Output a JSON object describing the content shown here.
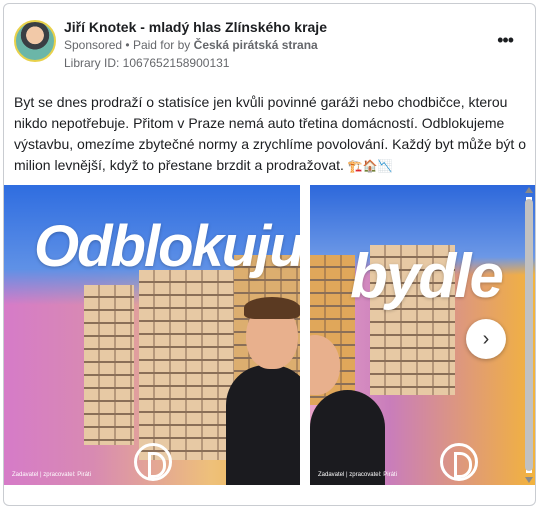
{
  "ad": {
    "page_name": "Jiří Knotek - mladý hlas Zlínského kraje",
    "sponsored_label": "Sponsored",
    "separator": "•",
    "paid_for_prefix": "Paid for by",
    "paid_for_by": "Česká pirátská strana",
    "library_id": "Library ID: 1067652158900131",
    "menu_label": "•••",
    "body_text": "Byt se dnes prodraží o statisíce jen kvůli povinné garáži nebo chodbičce, kterou nikdo nepotřebuje. Přitom v Praze nemá auto třetina domácností. Odblokujeme výstavbu, omezíme zbytečné normy a zrychlíme povolování. Každý byt může být o milion levnější, když to přestane brzdit a prodražovat.",
    "body_emojis": "🏗️🏠📉"
  },
  "carousel": {
    "slides": [
      {
        "headline": "Odblokuju",
        "caption": "Zadavatel | zpracovatel: Piráti"
      },
      {
        "headline": "bydle",
        "caption": "Zadavatel | zpracovatel: Piráti"
      }
    ],
    "next_icon": "chevron-right-icon",
    "next_glyph": "›"
  },
  "colors": {
    "pirate_accent": "#f2b43a",
    "pink": "#d67bc8",
    "sky_blue": "#2f6de0"
  }
}
